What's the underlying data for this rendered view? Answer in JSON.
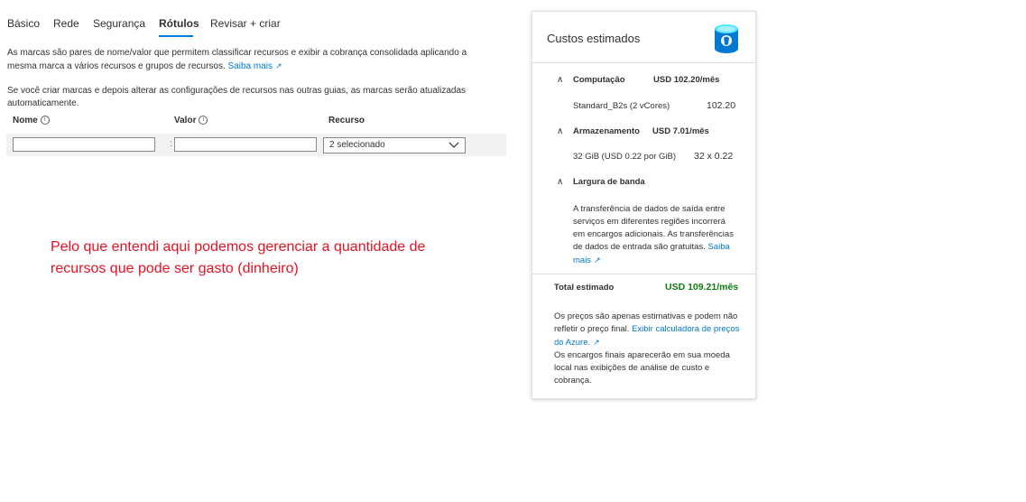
{
  "tabs": [
    {
      "label": "Básico"
    },
    {
      "label": "Rede"
    },
    {
      "label": "Segurança"
    },
    {
      "label": "Rótulos"
    },
    {
      "label": "Revisar + criar"
    }
  ],
  "active_tab": "Rótulos",
  "intro": {
    "text": "As marcas são pares de nome/valor que permitem classificar recursos e exibir a cobrança consolidada aplicando a mesma marca a vários recursos e grupos de recursos.",
    "link": "Saiba mais"
  },
  "warning": "Se você criar marcas e depois alterar as configurações de recursos nas outras guias, as marcas serão atualizadas automaticamente.",
  "table": {
    "headers": {
      "name": "Nome",
      "value": "Valor",
      "resource": "Recurso"
    },
    "row": {
      "name": "",
      "value": "",
      "colon": ":",
      "resource": "2 selecionado"
    }
  },
  "annotation": "Pelo que entendi aqui podemos gerenciar a quantidade de recursos que pode ser gasto (dinheiro)",
  "costs": {
    "title": "Custos estimados",
    "compute": {
      "label": "Computação",
      "price": "USD 102.20/mês",
      "item": "Standard_B2s (2 vCores)",
      "value": "102.20"
    },
    "storage": {
      "label": "Armazenamento",
      "price": "USD 7.01/mês",
      "item": "32 GiB (USD 0.22 por GiB)",
      "value": "32 x 0.22"
    },
    "bandwidth": {
      "label": "Largura de banda",
      "text": "A transferência de dados de saída entre serviços em diferentes regiões incorrerá em encargos adicionais. As transferências de dados de entrada são gratuitas.",
      "link": "Saiba mais"
    },
    "total": {
      "label": "Total estimado",
      "value": "USD 109.21/mês"
    },
    "note1": "Os preços são apenas estimativas e podem não refletir o preço final.",
    "note_link": "Exibir calculadora de preços do Azure.",
    "note2": "Os encargos finais aparecerão em sua moeda local nas exibições de análise de custo e cobrança."
  },
  "colors": {
    "accent": "#0078d4",
    "total": "#107c10",
    "annotation": "#e81123"
  }
}
